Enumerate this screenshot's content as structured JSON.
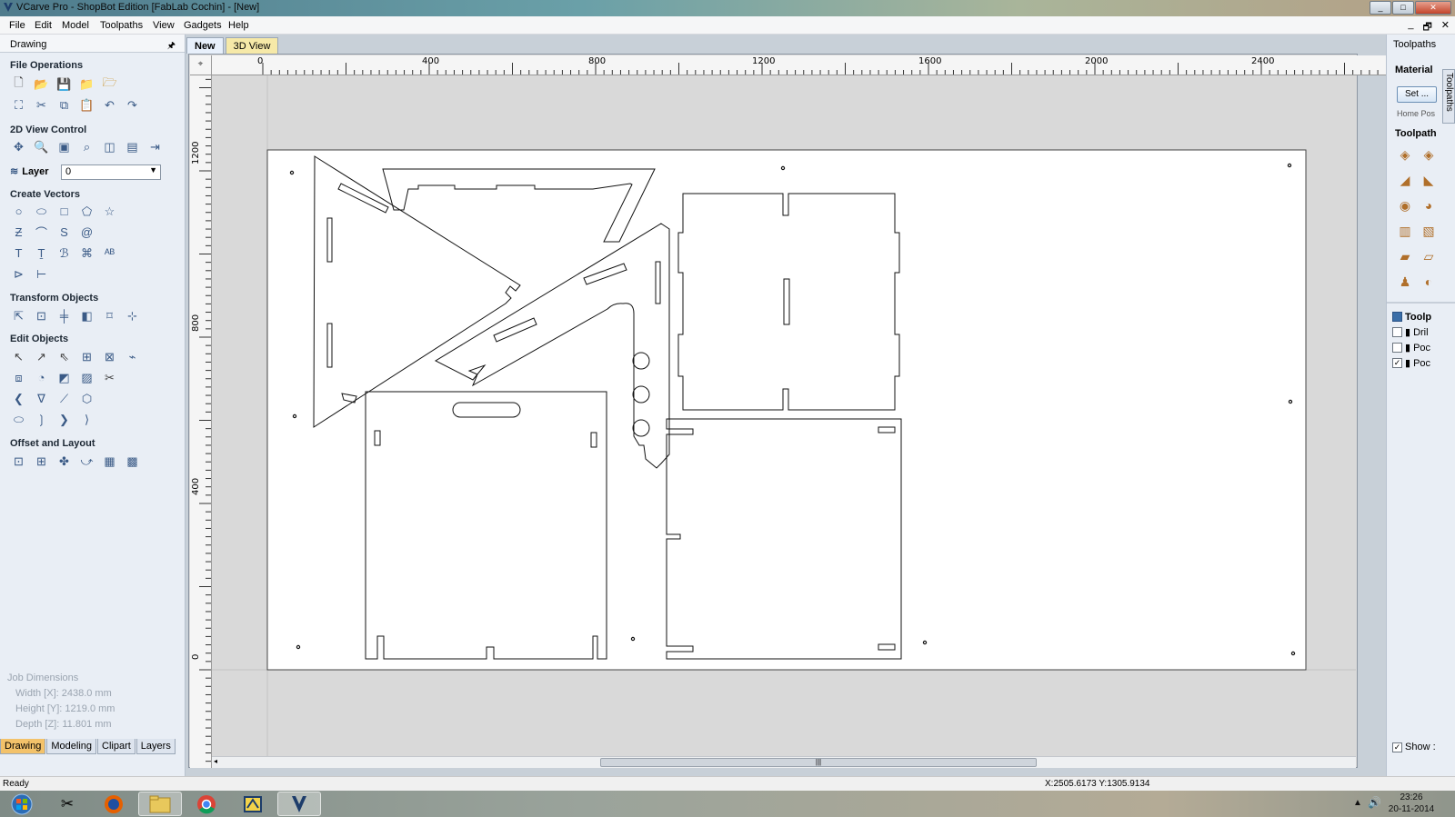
{
  "window": {
    "title": "VCarve Pro - ShopBot Edition [FabLab Cochin] - [New]",
    "buttons": [
      "_",
      "□",
      "✕"
    ]
  },
  "menu": {
    "items": [
      "File",
      "Edit",
      "Model",
      "Toolpaths",
      "View",
      "Gadgets",
      "Help"
    ],
    "mdi_buttons": [
      "_",
      "🗗",
      "✕"
    ]
  },
  "left_panel": {
    "header": "Drawing",
    "pin": "🖈",
    "sections": {
      "file_operations": "File Operations",
      "view_control": "2D View Control",
      "create_vectors": "Create Vectors",
      "transform_objects": "Transform Objects",
      "edit_objects": "Edit Objects",
      "offset_layout": "Offset and Layout"
    },
    "layer": {
      "label": "Layer",
      "value": "0"
    },
    "job_dimensions": {
      "title": "Job Dimensions",
      "width": "Width  [X]: 2438.0 mm",
      "height": "Height [Y]: 1219.0 mm",
      "depth": "Depth  [Z]: 11.801 mm"
    },
    "tabs": [
      "Drawing",
      "Modeling",
      "Clipart",
      "Layers"
    ],
    "active_tab": "Drawing"
  },
  "doc_tabs": [
    "New",
    "3D View"
  ],
  "rulers": {
    "top": [
      "0",
      "400",
      "800",
      "1200",
      "1600",
      "2000",
      "2400"
    ],
    "left": [
      "1200",
      "800",
      "400",
      "0"
    ]
  },
  "right_panel": {
    "title": "Toolpaths",
    "material": "Material",
    "set_button": "Set ...",
    "home_pos": "Home Pos",
    "toolpath": "Toolpath",
    "toolpaths_list_title": "Toolp",
    "list": [
      {
        "label": "Dril",
        "checked": false
      },
      {
        "label": "Poc",
        "checked": false
      },
      {
        "label": "Poc",
        "checked": true
      }
    ],
    "vertical_tab": "Toolpaths",
    "show_label": "Show :"
  },
  "status": {
    "ready": "Ready",
    "coords": "X:2505.6173 Y:1305.9134"
  },
  "taskbar": {
    "time": "23:26",
    "date": "20-11-2014"
  }
}
